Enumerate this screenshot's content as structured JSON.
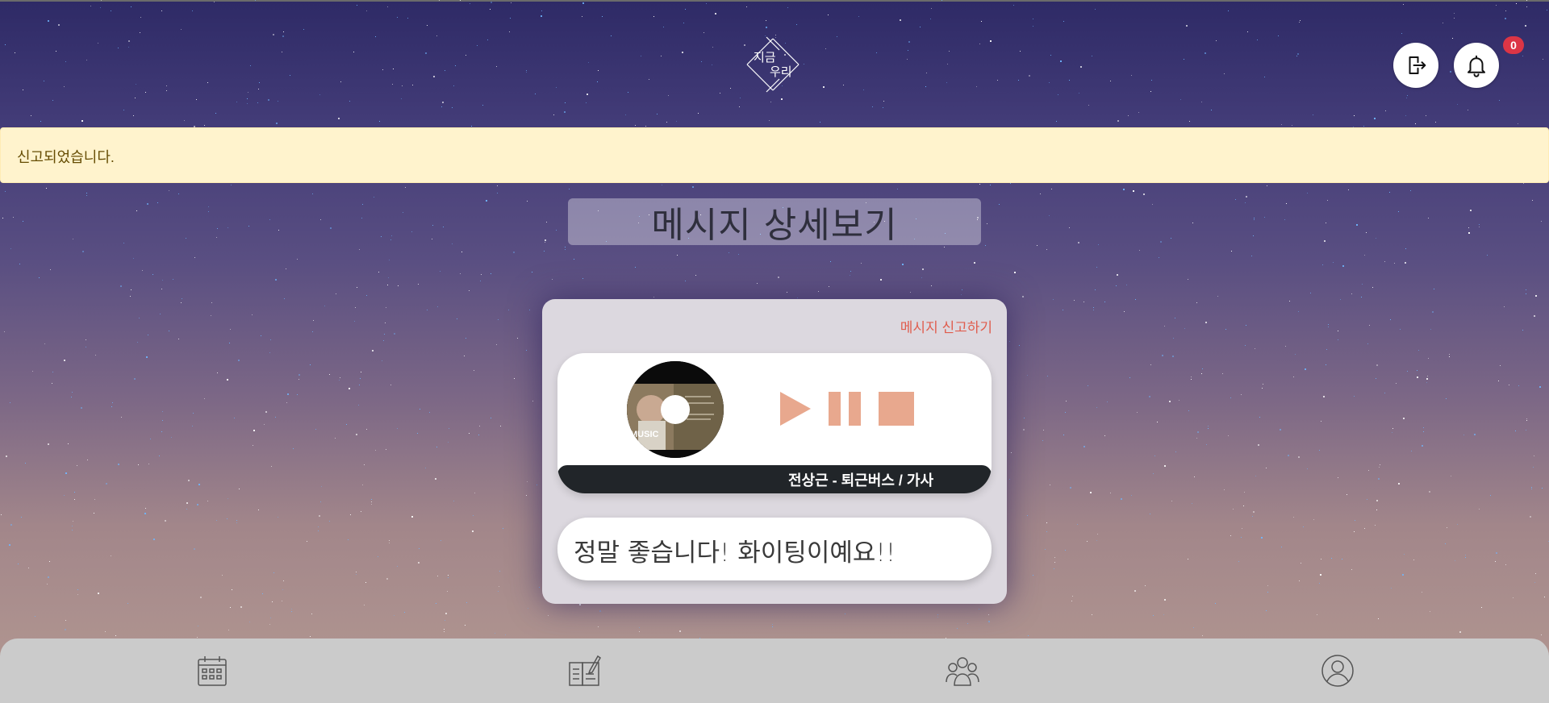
{
  "header": {
    "logo_text": "지금우리",
    "logo_icon": "diamond-cross-logo",
    "logout_icon": "logout-icon",
    "bell_icon": "bell-icon",
    "notification_count": "0"
  },
  "alert": {
    "message": "신고되었습니다."
  },
  "page": {
    "title": "메시지 상세보기"
  },
  "card": {
    "report_label": "메시지 신고하기",
    "player": {
      "album_art": "album-disc-image",
      "controls": [
        "play-icon",
        "pause-icon",
        "stop-icon"
      ],
      "control_color": "#e8a88e",
      "song_title": "전상근 - 퇴근버스 / 가사"
    },
    "message_text": "정말 좋습니다! 화이팅이예요!!"
  },
  "bottom_nav": {
    "items": [
      "calendar-icon",
      "diary-icon",
      "friends-icon",
      "profile-icon"
    ]
  },
  "colors": {
    "alert_bg": "#fff3cd",
    "alert_text": "#664d03",
    "badge": "#dc3545",
    "report_link": "#e05d4e",
    "song_bar": "#212529"
  }
}
